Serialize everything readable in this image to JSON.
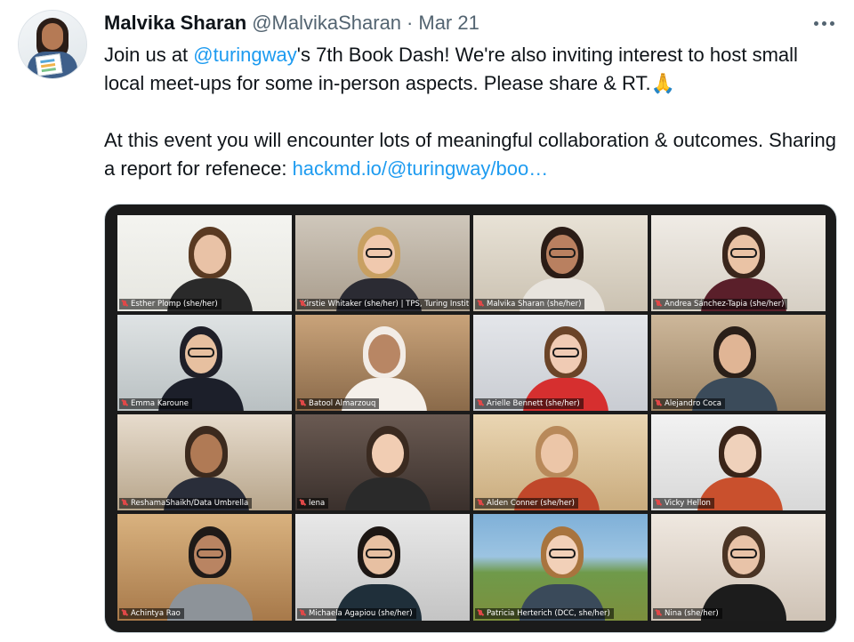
{
  "tweet": {
    "author_name": "Malvika Sharan",
    "handle": "@MalvikaSharan",
    "separator": "·",
    "date": "Mar 21",
    "para1_a": "Join us at ",
    "mention": "@turingway",
    "para1_b": "'s 7th Book Dash! We're also inviting interest to host small local meet-ups for some in-person aspects. Please share & RT.",
    "emoji": "🙏",
    "para2_a": "At this event you will encounter lots of meaningful collaboration & outcomes. Sharing a report for refenece: ",
    "link": "hackmd.io/@turingway/boo…"
  },
  "participants": [
    {
      "name": "Esther Plomp (she/her)"
    },
    {
      "name": "Kirstie Whitaker (she/her) | TPS, Turing Institute"
    },
    {
      "name": "Malvika Sharan  (she/her)"
    },
    {
      "name": "Andrea Sánchez-Tapia (she/her)"
    },
    {
      "name": "Emma Karoune"
    },
    {
      "name": "Batool Almarzouq"
    },
    {
      "name": "Arielle Bennett (she/her)"
    },
    {
      "name": "Alejandro Coca"
    },
    {
      "name": "ReshamaShaikh/Data Umbrella"
    },
    {
      "name": "lena"
    },
    {
      "name": "Alden Conner (she/her)"
    },
    {
      "name": "Vicky Hellon"
    },
    {
      "name": "Achintya Rao"
    },
    {
      "name": "Michaela Agapiou (she/her)"
    },
    {
      "name": "Patricia Herterich (DCC, she/her)"
    },
    {
      "name": "Nina (she/her)"
    }
  ],
  "active_speaker": "Kirstie Whitaker (she/her) | TPS, Turing Institute",
  "colors": {
    "link": "#1d9bf0",
    "secondary_text": "#536471",
    "active_border": "#b7d43a",
    "muted_mic": "#e04848"
  },
  "icons": {
    "more": "more-horizontal-icon",
    "mic": "mic-muted-icon",
    "emoji": "folded-hands-icon"
  }
}
